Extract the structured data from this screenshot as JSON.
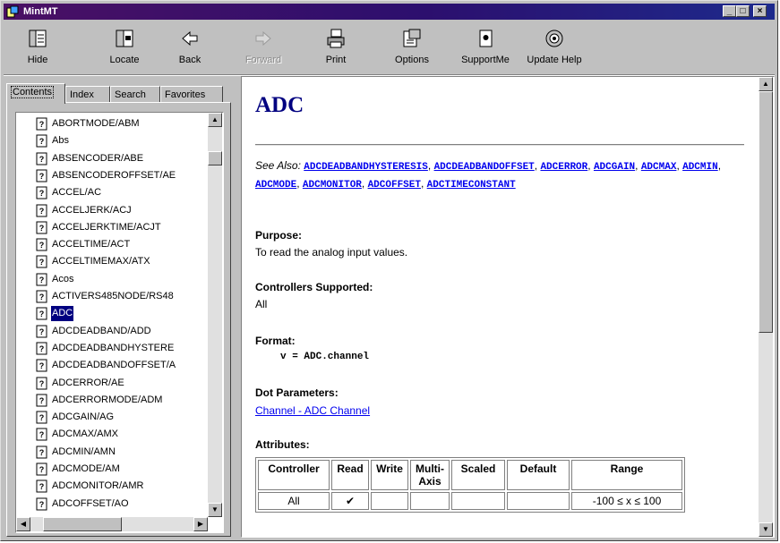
{
  "window": {
    "title": "MintMT",
    "controls": [
      "minimize",
      "maximize",
      "close"
    ]
  },
  "toolbar": {
    "buttons": [
      {
        "label": "Hide",
        "icon": "hide-icon",
        "enabled": true
      },
      {
        "label": "Locate",
        "icon": "locate-icon",
        "enabled": true
      },
      {
        "label": "Back",
        "icon": "back-arrow-icon",
        "enabled": true
      },
      {
        "label": "Forward",
        "icon": "forward-arrow-icon",
        "enabled": false
      },
      {
        "label": "Print",
        "icon": "printer-icon",
        "enabled": true
      },
      {
        "label": "Options",
        "icon": "options-icon",
        "enabled": true
      },
      {
        "label": "SupportMe",
        "icon": "support-icon",
        "enabled": true
      },
      {
        "label": "Update Help",
        "icon": "update-help-icon",
        "enabled": true
      }
    ]
  },
  "left_pane": {
    "tabs": [
      "Contents",
      "Index",
      "Search",
      "Favorites"
    ],
    "active_tab": "Contents",
    "tree_items": [
      "ABORTMODE/ABM",
      "Abs",
      "ABSENCODER/ABE",
      "ABSENCODEROFFSET/AE",
      "ACCEL/AC",
      "ACCELJERK/ACJ",
      "ACCELJERKTIME/ACJT",
      "ACCELTIME/ACT",
      "ACCELTIMEMAX/ATX",
      "Acos",
      "ACTIVERS485NODE/RS48",
      "ADC",
      "ADCDEADBAND/ADD",
      "ADCDEADBANDHYSTERE",
      "ADCDEADBANDOFFSET/A",
      "ADCERROR/AE",
      "ADCERRORMODE/ADM",
      "ADCGAIN/AG",
      "ADCMAX/AMX",
      "ADCMIN/AMN",
      "ADCMODE/AM",
      "ADCMONITOR/AMR",
      "ADCOFFSET/AO"
    ],
    "selected_item": "ADC"
  },
  "document": {
    "title": "ADC",
    "see_also_label": "See Also:",
    "see_also_links": [
      "ADCDEADBANDHYSTERESIS",
      "ADCDEADBANDOFFSET",
      "ADCERROR",
      "ADCGAIN",
      "ADCMAX",
      "ADCMIN",
      "ADCMODE",
      "ADCMONITOR",
      "ADCOFFSET",
      "ADCTIMECONSTANT"
    ],
    "purpose_heading": "Purpose:",
    "purpose_text": "To read the analog input values.",
    "controllers_heading": "Controllers Supported:",
    "controllers_text": "All",
    "format_heading": "Format:",
    "format_code": "v = ADC.channel",
    "dot_params_heading": "Dot Parameters:",
    "dot_params_link": "Channel - ADC Channel",
    "attributes_heading": "Attributes:",
    "attributes_table": {
      "headers": [
        "Controller",
        "Read",
        "Write",
        "Multi-\nAxis",
        "Scaled",
        "Default",
        "Range"
      ],
      "rows": [
        [
          "All",
          "✔",
          "",
          "",
          "",
          "",
          "-100 ≤ x ≤ 100"
        ]
      ]
    }
  }
}
